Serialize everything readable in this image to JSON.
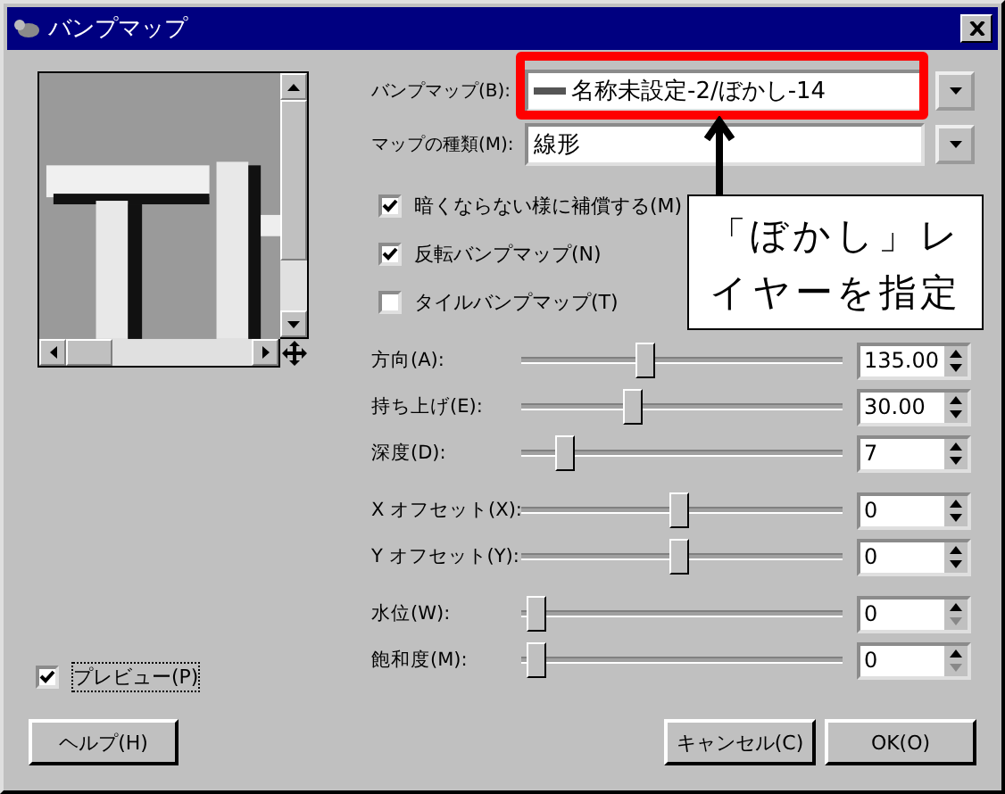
{
  "window": {
    "title": "バンプマップ"
  },
  "bumpmap": {
    "label": "バンプマップ(B):",
    "value": "名称未設定-2/ぼかし-14"
  },
  "map_type": {
    "label": "マップの種類(M):",
    "value": "線形"
  },
  "checkboxes": [
    {
      "label": "暗くならない様に補償する(M)",
      "checked": true
    },
    {
      "label": "反転バンプマップ(N)",
      "checked": true
    },
    {
      "label": "タイルバンプマップ(T)",
      "checked": false
    }
  ],
  "slider_groups": [
    [
      {
        "label": "方向(A):",
        "level": 0.38,
        "value": "135.00",
        "down_enabled": true
      },
      {
        "label": "持ち上げ(E):",
        "level": 0.34,
        "value": "30.00",
        "down_enabled": true
      },
      {
        "label": "深度(D):",
        "level": 0.11,
        "value": "7",
        "down_enabled": true
      }
    ],
    [
      {
        "label": "X オフセット(X):",
        "level": 0.49,
        "value": "0",
        "down_enabled": true
      },
      {
        "label": "Y オフセット(Y):",
        "level": 0.49,
        "value": "0",
        "down_enabled": true
      }
    ],
    [
      {
        "label": "水位(W):",
        "level": 0.02,
        "value": "0",
        "down_enabled": false
      },
      {
        "label": "飽和度(M):",
        "level": 0.02,
        "value": "0",
        "down_enabled": false
      }
    ]
  ],
  "preview": {
    "label": "プレビュー(P)",
    "checked": true
  },
  "buttons": [
    "ヘルプ(H)",
    "キャンセル(C)",
    "OK(O)"
  ],
  "annotation": {
    "text": "「ぼかし」レイヤーを指定"
  }
}
